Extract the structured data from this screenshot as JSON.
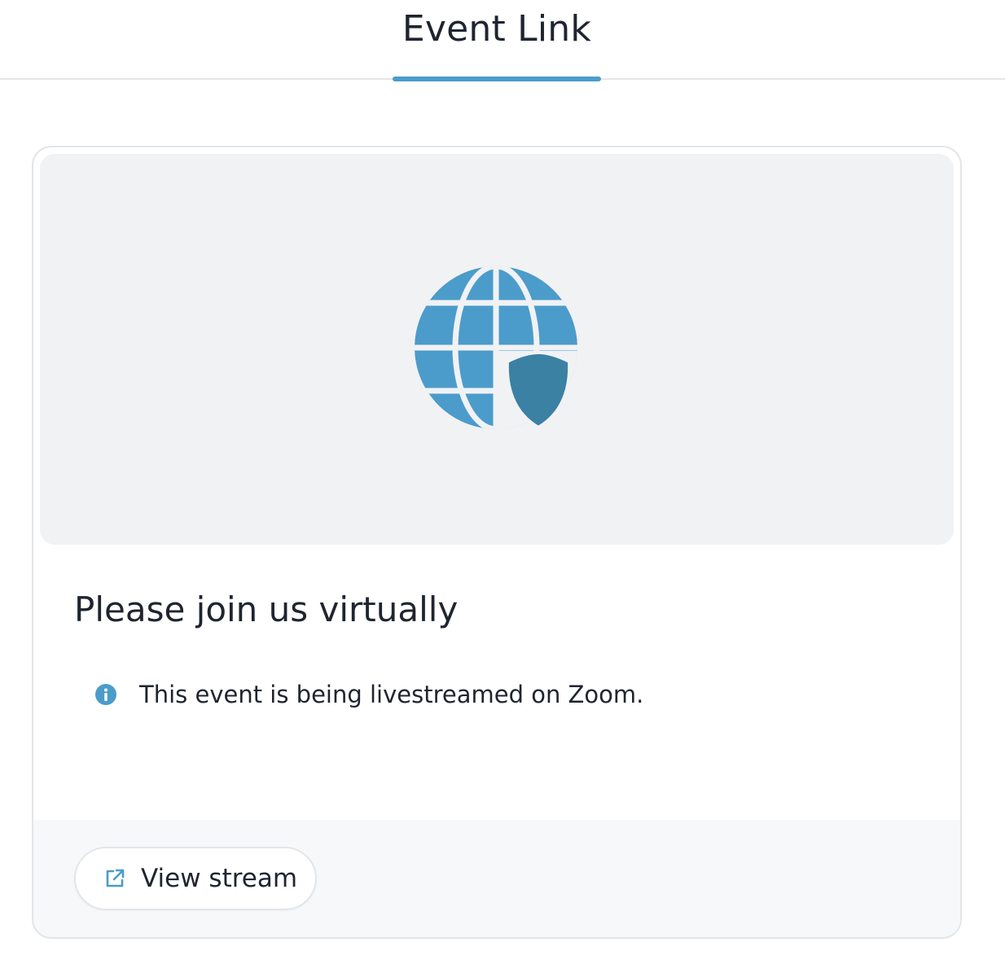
{
  "tabs": [
    {
      "label": "Event Link",
      "active": true
    }
  ],
  "card": {
    "title": "Please join us virtually",
    "info_text": "This event is being livestreamed on Zoom.",
    "hero_icon": "globe-shield-icon",
    "info_icon": "info-circle-icon",
    "button": {
      "label": "View stream",
      "icon": "external-link-icon"
    }
  },
  "colors": {
    "accent": "#4b9ccb",
    "accent_dark": "#3a81a3",
    "text": "#1f2430",
    "hero_bg": "#f1f2f4",
    "footer_bg": "#f7f8fa",
    "border": "#e3e5e8"
  }
}
